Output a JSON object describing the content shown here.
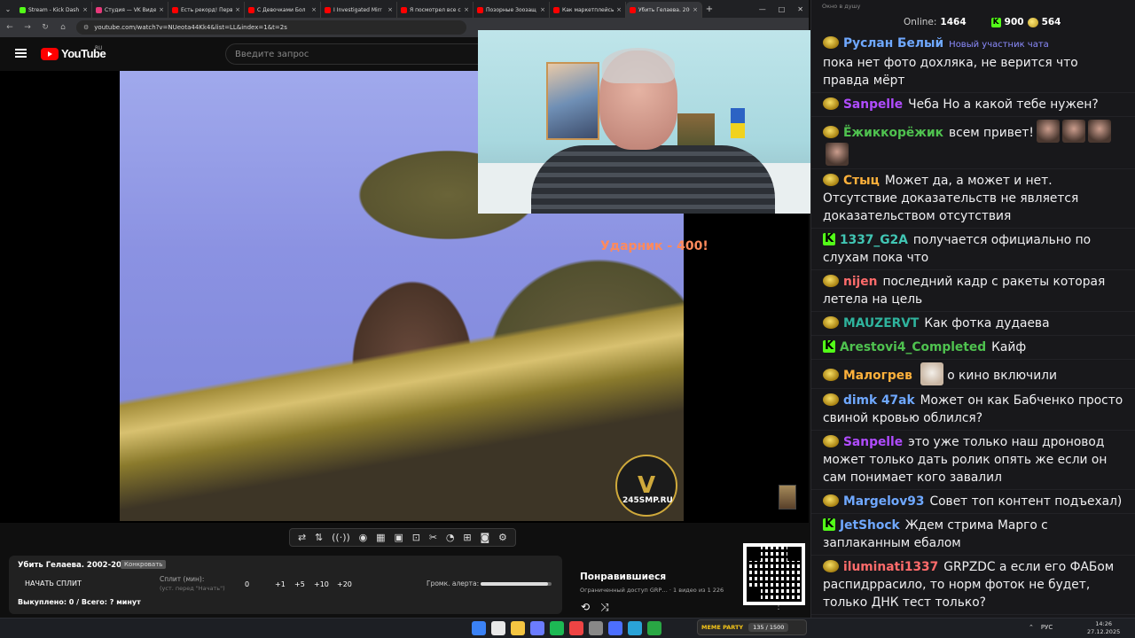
{
  "browser": {
    "tabs": [
      {
        "label": "Stream - Kick Dash",
        "color": "#53fc18",
        "active": false
      },
      {
        "label": "Студия — VK Видео",
        "color": "#e6397a",
        "active": false
      },
      {
        "label": "Есть рекорд! Перв",
        "color": "#ff0000",
        "active": false
      },
      {
        "label": "С Девочками Бол",
        "color": "#ff0000",
        "active": false
      },
      {
        "label": "I Investigated Mirr",
        "color": "#ff0000",
        "active": false
      },
      {
        "label": "Я посмотрел все с",
        "color": "#ff0000",
        "active": false
      },
      {
        "label": "Позорные Зоозащ",
        "color": "#ff0000",
        "active": false
      },
      {
        "label": "Как маркетплейсы",
        "color": "#ff0000",
        "active": false
      },
      {
        "label": "Убить Гелаева. 200",
        "color": "#ff0000",
        "active": true
      }
    ],
    "url": "youtube.com/watch?v=NUeota44Kk4&list=LL&index=1&t=2s",
    "window_controls": [
      "—",
      "□",
      "✕"
    ]
  },
  "youtube": {
    "logo": "YouTube",
    "region": "RU",
    "search_placeholder": "Введите запрос"
  },
  "video": {
    "overlay_text": "Ударник - 400!",
    "watermark_letter": "V",
    "watermark_text": "245SMP.RU"
  },
  "enhancer_icons": [
    "repeat-icon",
    "sort-icon",
    "broadcast-icon",
    "eye-icon",
    "film-icon",
    "picture-in-picture-icon",
    "clip-icon",
    "cut-icon",
    "speed-icon",
    "add-icon",
    "screenshot-icon",
    "settings-icon"
  ],
  "split_panel": {
    "title": "Убить Гелаева. 2002-2004.",
    "tag": "Конкровать",
    "start_label": "НАЧАТЬ СПЛИТ",
    "split_label": "Сплит (мин):",
    "split_hint": "(уст. перед \"Начать\")",
    "value": "0",
    "buttons": [
      "+1",
      "+5",
      "+10",
      "+20"
    ],
    "volume_label": "Громк. алерта:",
    "volume_level": 0.95,
    "bought": "Выкуплено: 0 / Всего: ? минут"
  },
  "playlist": {
    "title": "Понравившиеся",
    "meta": "Ограниченный доступ  GRP…  ·  1 видео из 1 226"
  },
  "chat": {
    "window_title": "Окно в душу",
    "online_label": "Online:",
    "online_value": "1464",
    "kick_value": "900",
    "coins_value": "564",
    "messages": [
      {
        "badge": "coin",
        "user": "Руслан Белый",
        "color": "#6fa8ff",
        "note": "Новый участник чата",
        "text": "пока нет фото дохляка, не верится что правда мёрт"
      },
      {
        "badge": "coin",
        "user": "Sanpelle",
        "color": "#b04cff",
        "text": "Чеба Но а какой  тебе нужен?"
      },
      {
        "badge": "coin",
        "user": "Ёжиккорёжик",
        "color": "#4fc24f",
        "text": "всем привет!",
        "emotes": 4
      },
      {
        "badge": "coin",
        "user": "Стыц",
        "color": "#ffb13b",
        "text": "Может да, а может и нет. Отсутствие доказательств не является доказательством отсутствия"
      },
      {
        "badge": "kick",
        "user": "1337_G2A",
        "color": "#41c6b4",
        "text": "получается официально по слухам пока что"
      },
      {
        "badge": "coin",
        "user": "nijen",
        "color": "#ff6b6b",
        "text": "последний кадр с ракеты которая летела на цель"
      },
      {
        "badge": "coin",
        "user": "MAUZERVT",
        "color": "#2fb39d",
        "text": "Как фотка дудаева"
      },
      {
        "badge": "kick",
        "user": "Arestovi4_Completed",
        "color": "#4fc24f",
        "text": "Кайф"
      },
      {
        "badge": "coin",
        "user": "Малогрев",
        "color": "#ffb13b",
        "text": "о кино включили",
        "emotes": 1,
        "emote_before": true
      },
      {
        "badge": "coin",
        "user": "dimk 47ak",
        "color": "#6fa8ff",
        "text": "Может он как Бабченко просто свиной кровью облился?"
      },
      {
        "badge": "coin",
        "user": "Sanpelle",
        "color": "#b04cff",
        "text": "это уже только наш дроновод может только дать ролик опять же если он сам понимает кого завалил"
      },
      {
        "badge": "coin",
        "user": "Margelov93",
        "color": "#6fa8ff",
        "text": "Совет топ контент подъехал)"
      },
      {
        "badge": "kick",
        "user": "JetShock",
        "color": "#6fa8ff",
        "text": "Ждем стрима Марго с заплаканным ебалом"
      },
      {
        "badge": "coin",
        "user": "iluminati1337",
        "color": "#ff6b6b",
        "text": "GRPZDC а если его ФАБом распидррасило, то норм фоток не будет, только ДНК тест только?"
      }
    ]
  },
  "taskbar": {
    "media_label": "MEME PARTY",
    "media_progress": "135 / 1500",
    "lang": "РУС",
    "time": "14:26",
    "date": "27.12.2025"
  }
}
